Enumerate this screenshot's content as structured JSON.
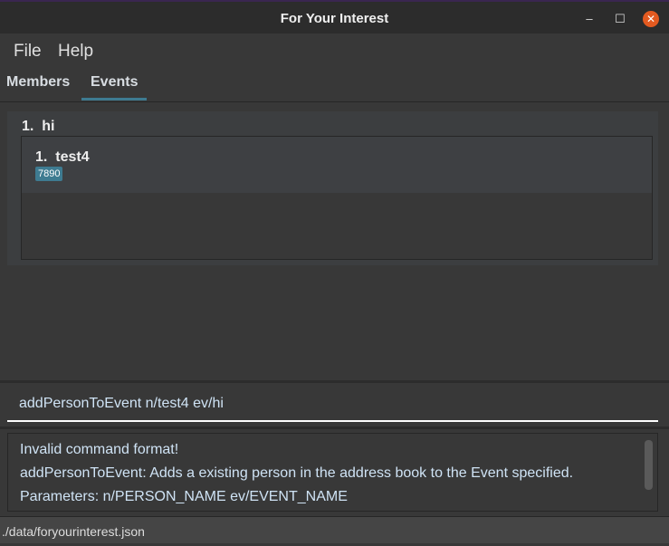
{
  "window": {
    "title": "For Your Interest",
    "controls": {
      "minimize": "–",
      "maximize": "☐",
      "close": "✕"
    }
  },
  "menu": {
    "items": [
      {
        "label": "File"
      },
      {
        "label": "Help"
      }
    ]
  },
  "tabs": [
    {
      "label": "Members",
      "active": false
    },
    {
      "label": "Events",
      "active": true
    }
  ],
  "events": [
    {
      "index": "1.",
      "name": "hi",
      "members": [
        {
          "index": "1.",
          "name": "test4",
          "tags": [
            "7890"
          ]
        }
      ]
    }
  ],
  "command": {
    "value": "addPersonToEvent n/test4 ev/hi"
  },
  "result": {
    "lines": [
      "Invalid command format!",
      "addPersonToEvent: Adds a existing person in the address book to the Event specified.",
      "Parameters: n/PERSON_NAME ev/EVENT_NAME"
    ]
  },
  "status": {
    "path": "./data/foryourinterest.json"
  },
  "colors": {
    "accent": "#3e7b91",
    "close": "#e35a20",
    "background": "#383838"
  }
}
